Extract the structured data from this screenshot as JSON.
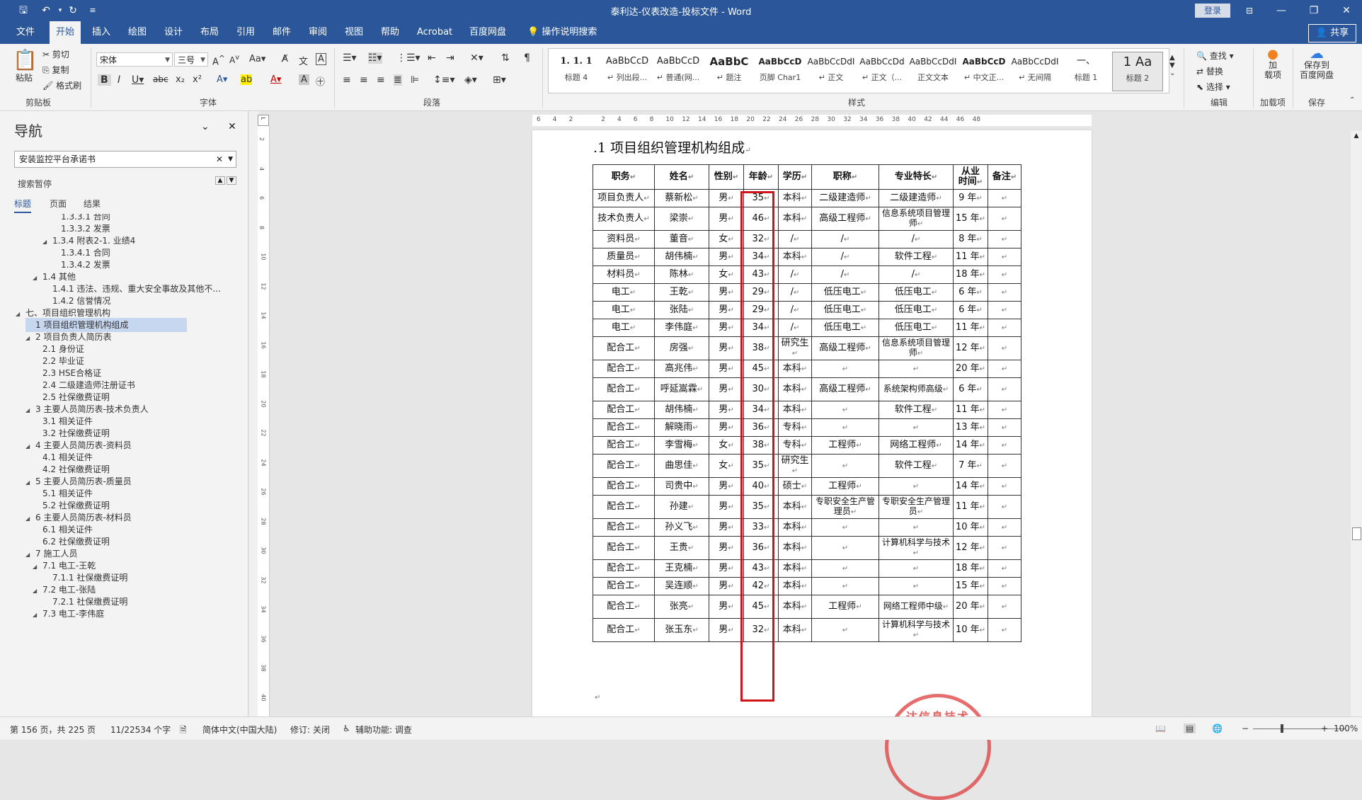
{
  "window": {
    "title": "泰利达-仪表改造-投标文件 - Word",
    "login": "登录",
    "controls": {
      "minimize": "—",
      "restore": "❐",
      "close": "✕"
    }
  },
  "quick_access": {
    "save_icon": "save-icon",
    "undo_icon": "undo-icon",
    "redo_icon": "redo-icon",
    "more_icon": "customize-icon"
  },
  "ribbon_tabs": [
    "文件",
    "开始",
    "插入",
    "绘图",
    "设计",
    "布局",
    "引用",
    "邮件",
    "审阅",
    "视图",
    "帮助",
    "Acrobat",
    "百度网盘"
  ],
  "tell_me": "操作说明搜索",
  "share": "共享",
  "clipboard": {
    "paste": "粘贴",
    "cut": "剪切",
    "copy": "复制",
    "format_painter": "格式刷",
    "label": "剪贴板"
  },
  "font": {
    "family": "宋体",
    "size": "三号",
    "label": "字体"
  },
  "paragraph": {
    "label": "段落"
  },
  "styles": {
    "label": "样式",
    "items": [
      {
        "preview": "1. 1. 1",
        "name": "标题 4"
      },
      {
        "preview": "AaBbCcD",
        "name": "↵ 列出段..."
      },
      {
        "preview": "AaBbCcD",
        "name": "↵ 普通(网..."
      },
      {
        "preview": "AaBbC",
        "name": "↵ 题注"
      },
      {
        "preview": "AaBbCcD",
        "name": "页脚 Char1"
      },
      {
        "preview": "AaBbCcDdI",
        "name": "↵ 正文"
      },
      {
        "preview": "AaBbCcDd",
        "name": "↵ 正文（..."
      },
      {
        "preview": "AaBbCcDdI",
        "name": "正文文本"
      },
      {
        "preview": "AaBbCcD",
        "name": "↵ 中文正..."
      },
      {
        "preview": "AaBbCcDdI",
        "name": "↵ 无间隔"
      },
      {
        "preview": "一、",
        "name": "标题 1"
      },
      {
        "preview": "1  Aa",
        "name": "标题 2"
      }
    ]
  },
  "editing": {
    "find": "查找",
    "replace": "替换",
    "select": "选择",
    "label": "编辑"
  },
  "addins": {
    "btn": "加\n载项",
    "label": "加载项"
  },
  "save_group": {
    "btn": "保存到\n百度网盘",
    "label": "保存"
  },
  "nav": {
    "title": "导航",
    "search_value": "安装监控平台承诺书",
    "status": "搜索暂停",
    "tabs": [
      "标题",
      "页面",
      "结果"
    ],
    "tree": [
      {
        "level": 4,
        "text": "1.3.3.1 合同",
        "tri": ""
      },
      {
        "level": 4,
        "text": "1.3.3.2 发票",
        "tri": ""
      },
      {
        "level": 3,
        "text": "1.3.4 附表2-1. 业绩4",
        "tri": "◢"
      },
      {
        "level": 4,
        "text": "1.3.4.1 合同",
        "tri": ""
      },
      {
        "level": 4,
        "text": "1.3.4.2 发票",
        "tri": ""
      },
      {
        "level": 2,
        "text": "1.4 其他",
        "tri": "◢"
      },
      {
        "level": 3,
        "text": "1.4.1 违法、违规、重大安全事故及其他不...",
        "tri": ""
      },
      {
        "level": 3,
        "text": "1.4.2 信誉情况",
        "tri": ""
      },
      {
        "level": 0,
        "text": "七、项目组织管理机构",
        "tri": "◢"
      },
      {
        "level": 1,
        "text": "1 项目组织管理机构组成",
        "tri": "",
        "selected": true
      },
      {
        "level": 1,
        "text": "2 项目负责人简历表",
        "tri": "◢"
      },
      {
        "level": 2,
        "text": "2.1 身份证",
        "tri": ""
      },
      {
        "level": 2,
        "text": "2.2 毕业证",
        "tri": ""
      },
      {
        "level": 2,
        "text": "2.3 HSE合格证",
        "tri": ""
      },
      {
        "level": 2,
        "text": "2.4 二级建造师注册证书",
        "tri": ""
      },
      {
        "level": 2,
        "text": "2.5 社保缴费证明",
        "tri": ""
      },
      {
        "level": 1,
        "text": "3 主要人员简历表-技术负责人",
        "tri": "◢"
      },
      {
        "level": 2,
        "text": "3.1 相关证件",
        "tri": ""
      },
      {
        "level": 2,
        "text": "3.2 社保缴费证明",
        "tri": ""
      },
      {
        "level": 1,
        "text": "4 主要人员简历表-资料员",
        "tri": "◢"
      },
      {
        "level": 2,
        "text": "4.1 相关证件",
        "tri": ""
      },
      {
        "level": 2,
        "text": "4.2 社保缴费证明",
        "tri": ""
      },
      {
        "level": 1,
        "text": "5 主要人员简历表-质量员",
        "tri": "◢"
      },
      {
        "level": 2,
        "text": "5.1 相关证件",
        "tri": ""
      },
      {
        "level": 2,
        "text": "5.2 社保缴费证明",
        "tri": ""
      },
      {
        "level": 1,
        "text": "6 主要人员简历表-材料员",
        "tri": "◢"
      },
      {
        "level": 2,
        "text": "6.1 相关证件",
        "tri": ""
      },
      {
        "level": 2,
        "text": "6.2 社保缴费证明",
        "tri": ""
      },
      {
        "level": 1,
        "text": "7 施工人员",
        "tri": "◢"
      },
      {
        "level": 2,
        "text": "7.1 电工-王乾",
        "tri": "◢"
      },
      {
        "level": 3,
        "text": "7.1.1 社保缴费证明",
        "tri": ""
      },
      {
        "level": 2,
        "text": "7.2 电工-张陆",
        "tri": "◢"
      },
      {
        "level": 3,
        "text": "7.2.1 社保缴费证明",
        "tri": ""
      },
      {
        "level": 2,
        "text": "7.3 电工-李伟庭",
        "tri": "◢"
      }
    ]
  },
  "ruler": {
    "h_ticks": [
      "6",
      "4",
      "2",
      "",
      "2",
      "4",
      "6",
      "8",
      "10",
      "12",
      "14",
      "16",
      "18",
      "20",
      "22",
      "24",
      "26",
      "28",
      "30",
      "32",
      "34",
      "36",
      "38",
      "40",
      "42",
      "44",
      "46",
      "48"
    ],
    "v_ticks": [
      "2",
      "4",
      "6",
      "8",
      "10",
      "12",
      "14",
      "16",
      "18",
      "20",
      "22",
      "24",
      "26",
      "28",
      "30",
      "32",
      "34",
      "36",
      "38",
      "40"
    ]
  },
  "doc": {
    "heading": ".1   项目组织管理机构组成",
    "headers": [
      "职务",
      "姓名",
      "性别",
      "年龄",
      "学历",
      "职称",
      "专业特长",
      "从业\n时间",
      "备注"
    ],
    "rows": [
      [
        "项目负责人",
        "蔡新松",
        "男",
        "35",
        "本科",
        "二级建造师",
        "二级建造师",
        "9 年",
        ""
      ],
      [
        "技术负责人",
        "梁崇",
        "男",
        "46",
        "本科",
        "高级工程师",
        "信息系统项目管理师",
        "15 年",
        ""
      ],
      [
        "资料员",
        "董音",
        "女",
        "32",
        "/",
        "/",
        "/",
        "8 年",
        ""
      ],
      [
        "质量员",
        "胡伟楠",
        "男",
        "34",
        "本科",
        "/",
        "软件工程",
        "11 年",
        ""
      ],
      [
        "材料员",
        "陈林",
        "女",
        "43",
        "/",
        "/",
        "/",
        "18 年",
        ""
      ],
      [
        "电工",
        "王乾",
        "男",
        "29",
        "/",
        "低压电工",
        "低压电工",
        "6 年",
        ""
      ],
      [
        "电工",
        "张陆",
        "男",
        "29",
        "/",
        "低压电工",
        "低压电工",
        "6 年",
        ""
      ],
      [
        "电工",
        "李伟庭",
        "男",
        "34",
        "/",
        "低压电工",
        "低压电工",
        "11 年",
        ""
      ],
      [
        "配合工",
        "房强",
        "男",
        "38",
        "研究生",
        "高级工程师",
        "信息系统项目管理师",
        "12 年",
        ""
      ],
      [
        "配合工",
        "高兆伟",
        "男",
        "45",
        "本科",
        "",
        "",
        "20 年",
        ""
      ],
      [
        "配合工",
        "呼延嵩霖",
        "男",
        "30",
        "本科",
        "高级工程师",
        "系统架构师高级",
        "6 年",
        ""
      ],
      [
        "配合工",
        "胡伟楠",
        "男",
        "34",
        "本科",
        "",
        "软件工程",
        "11 年",
        ""
      ],
      [
        "配合工",
        "解晓雨",
        "男",
        "36",
        "专科",
        "",
        "",
        "13 年",
        ""
      ],
      [
        "配合工",
        "李雪梅",
        "女",
        "38",
        "专科",
        "工程师",
        "网络工程师",
        "14 年",
        ""
      ],
      [
        "配合工",
        "曲思佳",
        "女",
        "35",
        "研究生",
        "",
        "软件工程",
        "7 年",
        ""
      ],
      [
        "配合工",
        "司贵中",
        "男",
        "40",
        "硕士",
        "工程师",
        "",
        "14 年",
        ""
      ],
      [
        "配合工",
        "孙建",
        "男",
        "35",
        "本科",
        "专职安全生产管理员",
        "专职安全生产管理员",
        "11 年",
        ""
      ],
      [
        "配合工",
        "孙义飞",
        "男",
        "33",
        "本科",
        "",
        "",
        "10 年",
        ""
      ],
      [
        "配合工",
        "王贵",
        "男",
        "36",
        "本科",
        "",
        "计算机科学与技术",
        "12 年",
        ""
      ],
      [
        "配合工",
        "王克楠",
        "男",
        "43",
        "本科",
        "",
        "",
        "18 年",
        ""
      ],
      [
        "配合工",
        "吴连顺",
        "男",
        "42",
        "本科",
        "",
        "",
        "15 年",
        ""
      ],
      [
        "配合工",
        "张亮",
        "男",
        "45",
        "本科",
        "工程师",
        "网络工程师中级",
        "20 年",
        ""
      ],
      [
        "配合工",
        "张玉东",
        "男",
        "32",
        "本科",
        "",
        "计算机科学与技术",
        "10 年",
        ""
      ]
    ],
    "highlight_color": "#d0141c",
    "stamp_text": "达信息技术"
  },
  "status": {
    "page": "第 156 页，共 225 页",
    "words": "11/22534 个字",
    "language": "简体中文(中国大陆)",
    "track": "修订: 关闭",
    "accessibility": "辅助功能: 调查",
    "zoom": "100%"
  },
  "colors": {
    "brand": "#2b579a",
    "highlight": "#d0141c"
  }
}
